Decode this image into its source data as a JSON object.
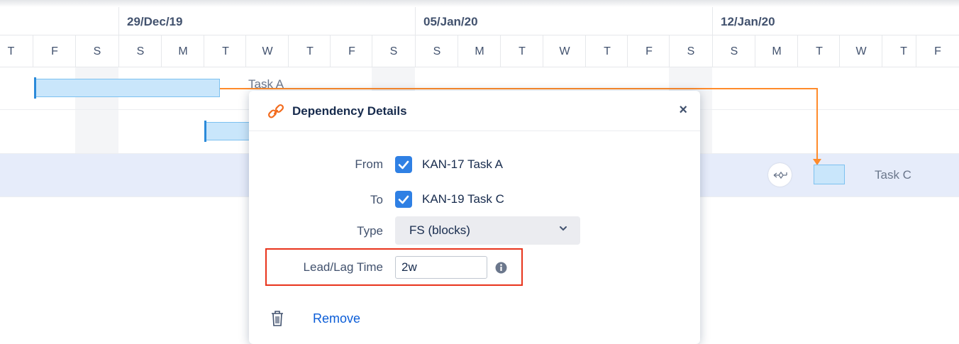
{
  "timeline": {
    "weeks": [
      "29/Dec/19",
      "05/Jan/20",
      "12/Jan/20"
    ],
    "days": [
      "T",
      "F",
      "S",
      "S",
      "M",
      "T",
      "W",
      "T",
      "F",
      "S",
      "S",
      "M",
      "T",
      "W",
      "T",
      "F",
      "S",
      "S",
      "M",
      "T",
      "W",
      "T",
      "F"
    ]
  },
  "tasks": {
    "task_a_label": "Task A",
    "task_c_label": "Task C"
  },
  "dialog": {
    "title": "Dependency Details",
    "close_label": "×",
    "from_label": "From",
    "from_value": "KAN-17 Task A",
    "to_label": "To",
    "to_value": "KAN-19 Task C",
    "type_label": "Type",
    "type_value": "FS (blocks)",
    "lead_lag_label": "Lead/Lag Time",
    "lead_lag_value": "2w",
    "remove_label": "Remove"
  },
  "colors": {
    "accent": "#2f80e4",
    "dependency_line": "#ff8b2b",
    "highlight_box": "#e8341c",
    "task_bar": "#c9e6fb"
  },
  "icons": [
    "link-icon",
    "close-icon",
    "check-icon",
    "chevron-down-icon",
    "info-icon",
    "trash-icon",
    "dependency-handle-icon"
  ]
}
